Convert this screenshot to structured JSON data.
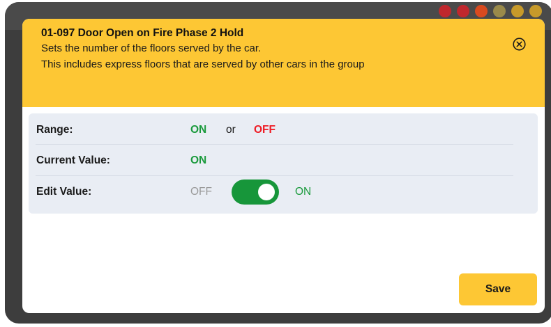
{
  "modal": {
    "title": "01-097 Door Open on Fire Phase 2 Hold",
    "description_line1": "Sets the number of the floors served by the car.",
    "description_line2": "This includes express floors that are served by other cars in the group",
    "close_icon": "close-circle-icon"
  },
  "settings": {
    "range": {
      "label": "Range:",
      "on": "ON",
      "or": "or",
      "off": "OFF"
    },
    "current": {
      "label": "Current Value:",
      "value": "ON"
    },
    "edit": {
      "label": "Edit Value:",
      "off_label": "OFF",
      "on_label": "ON",
      "toggle_state": "on"
    }
  },
  "actions": {
    "save_label": "Save"
  },
  "colors": {
    "header": "#fdc734",
    "on_green": "#1a9a3c",
    "off_red": "#ee1c25",
    "toggle_green": "#17963a",
    "panel_bg": "#e9edf4",
    "frame": "#3d3d3d"
  }
}
